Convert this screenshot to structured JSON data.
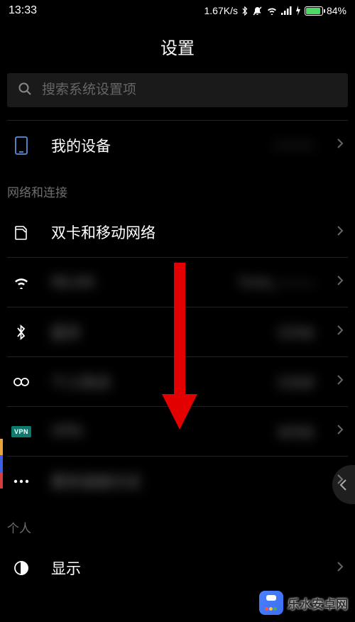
{
  "statusBar": {
    "time": "13:33",
    "netSpeed": "1.67K/s",
    "batteryPct": "84%"
  },
  "title": "设置",
  "search": {
    "placeholder": "搜索系统设置项"
  },
  "device": {
    "label": "我的设备",
    "value": "———"
  },
  "sections": {
    "network": {
      "header": "网络和连接"
    },
    "personal": {
      "header": "个人"
    }
  },
  "items": {
    "sim": {
      "label": "双卡和移动网络"
    },
    "wifi": {
      "label": "WLAN",
      "value": "Tenda_———"
    },
    "bt": {
      "label": "蓝牙",
      "value": "已开启"
    },
    "hotspot": {
      "label": "个人热点",
      "value": "已关闭"
    },
    "vpn": {
      "label": "VPN",
      "value": "未开启",
      "badge": "VPN"
    },
    "more": {
      "label": "更多连接方式"
    },
    "display": {
      "label": "显示"
    }
  },
  "watermark": {
    "text": "乐水安卓网"
  }
}
